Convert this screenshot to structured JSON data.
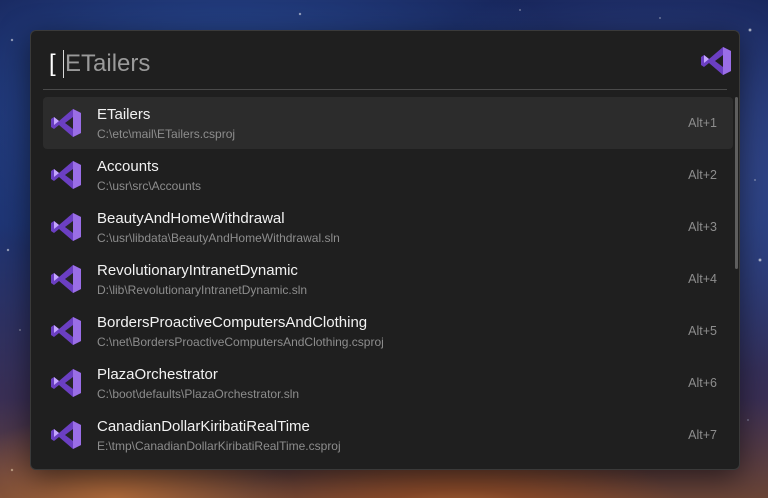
{
  "search": {
    "prefix": "[",
    "value": "",
    "placeholder": "ETailers"
  },
  "brand": {
    "icon": "visual-studio-logo-icon",
    "colors": {
      "dark": "#6b3fc2",
      "mid": "#9a6ee6",
      "light": "#c5a6ff"
    }
  },
  "results": [
    {
      "name": "ETailers",
      "path": "C:\\etc\\mail\\ETailers.csproj",
      "shortcut": "Alt+1",
      "selected": true
    },
    {
      "name": "Accounts",
      "path": "C:\\usr\\src\\Accounts",
      "shortcut": "Alt+2"
    },
    {
      "name": "BeautyAndHomeWithdrawal",
      "path": "C:\\usr\\libdata\\BeautyAndHomeWithdrawal.sln",
      "shortcut": "Alt+3"
    },
    {
      "name": "RevolutionaryIntranetDynamic",
      "path": "D:\\lib\\RevolutionaryIntranetDynamic.sln",
      "shortcut": "Alt+4"
    },
    {
      "name": "BordersProactiveComputersAndClothing",
      "path": "C:\\net\\BordersProactiveComputersAndClothing.csproj",
      "shortcut": "Alt+5"
    },
    {
      "name": "PlazaOrchestrator",
      "path": "C:\\boot\\defaults\\PlazaOrchestrator.sln",
      "shortcut": "Alt+6"
    },
    {
      "name": "CanadianDollarKiribatiRealTime",
      "path": "E:\\tmp\\CanadianDollarKiribatiRealTime.csproj",
      "shortcut": "Alt+7"
    }
  ]
}
